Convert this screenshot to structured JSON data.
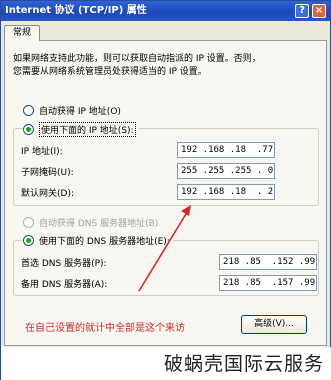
{
  "window": {
    "title": "Internet 协议 (TCP/IP) 属性",
    "help_glyph": "?",
    "close_glyph": "×"
  },
  "tabs": [
    "常规"
  ],
  "intro_text": "如果网络支持此功能，则可以获取自动指派的 IP 设置。否则，\n您需要从网络系统管理员处获得适当的 IP 设置。",
  "ip_section": {
    "auto_label": "自动获得 IP 地址(O)",
    "manual_label": "使用下面的 IP 地址(S):",
    "auto_selected": false,
    "manual_selected": true,
    "fields": [
      {
        "label": "IP 地址(I):",
        "value": "192 .168 .18  .77"
      },
      {
        "label": "子网掩码(U):",
        "value": "255 .255 .255 . 0"
      },
      {
        "label": "默认网关(D):",
        "value": "192 .168 .18  . 2"
      }
    ]
  },
  "dns_section": {
    "auto_label": "自动获得 DNS 服务器地址(B)",
    "manual_label": "使用下面的 DNS 服务器地址(E):",
    "auto_enabled": false,
    "manual_selected": true,
    "fields": [
      {
        "label": "首选 DNS 服务器(P):",
        "value": "218 .85  .152 .99"
      },
      {
        "label": "备用 DNS 服务器(A):",
        "value": "218 .85  .157 .99"
      }
    ]
  },
  "annotation_text": "在自己设置的就计中全部是这个来访",
  "advanced_button": "高级(V)...",
  "watermark": "破蜗壳国际云服务",
  "colors": {
    "titlebar": "#1b47b8",
    "annotation_red": "#d22a2a",
    "radio_dot": "#21a121"
  }
}
